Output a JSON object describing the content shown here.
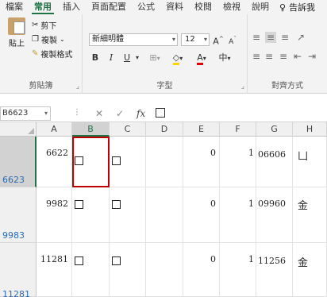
{
  "tabs": [
    {
      "label": "檔案",
      "active": false
    },
    {
      "label": "常用",
      "active": true
    },
    {
      "label": "插入",
      "active": false
    },
    {
      "label": "頁面配置",
      "active": false
    },
    {
      "label": "公式",
      "active": false
    },
    {
      "label": "資料",
      "active": false
    },
    {
      "label": "校閱",
      "active": false
    },
    {
      "label": "檢視",
      "active": false
    },
    {
      "label": "說明",
      "active": false
    }
  ],
  "tell_me": "告訴我",
  "ribbon": {
    "clipboard": {
      "paste": "貼上",
      "cut": "剪下",
      "copy": "複製",
      "format_painter": "複製格式",
      "group_label": "剪貼簿"
    },
    "font": {
      "font_name": "新細明體",
      "font_size": "12",
      "bold": "B",
      "italic": "I",
      "underline": "U",
      "grow": "A",
      "shrink": "A",
      "font_color": "A",
      "phonetic": "中",
      "group_label": "字型"
    },
    "alignment": {
      "group_label": "對齊方式"
    }
  },
  "name_box": "B6623",
  "columns": [
    "A",
    "B",
    "C",
    "D",
    "E",
    "F",
    "G",
    "H"
  ],
  "rows": [
    {
      "header": "6623",
      "a": "6622",
      "e": "0",
      "f": "1",
      "g": "06606",
      "h": "凵"
    },
    {
      "header": "9983",
      "a": "9982",
      "e": "0",
      "f": "1",
      "g": "09960",
      "h": "金"
    },
    {
      "header": "11281",
      "a": "11281",
      "e": "0",
      "f": "1",
      "g": "11256",
      "h": "金"
    }
  ],
  "colors": {
    "accent": "#217346",
    "selection_border": "#c00000",
    "row_header_text": "#2b6cb0"
  }
}
